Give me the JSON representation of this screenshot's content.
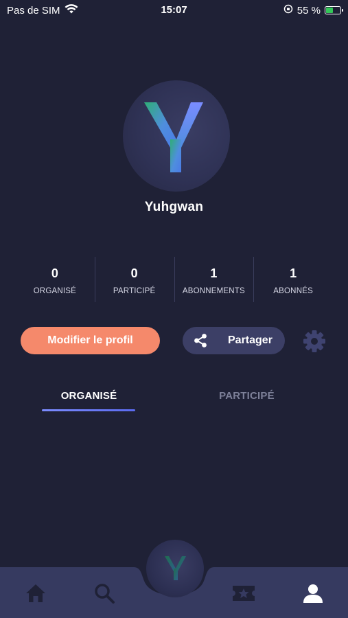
{
  "status_bar": {
    "carrier": "Pas de SIM",
    "time": "15:07",
    "battery_percent": "55 %",
    "battery_level": 0.55
  },
  "profile": {
    "avatar_letter": "Y",
    "username": "Yuhgwan"
  },
  "stats": [
    {
      "value": "0",
      "label": "ORGANISÉ"
    },
    {
      "value": "0",
      "label": "PARTICIPÉ"
    },
    {
      "value": "1",
      "label": "ABONNEMENTS"
    },
    {
      "value": "1",
      "label": "ABONNÉS"
    }
  ],
  "actions": {
    "edit_label": "Modifier le profil",
    "share_label": "Partager"
  },
  "tabs": {
    "organized": "ORGANISÉ",
    "participated": "PARTICIPÉ",
    "active": "organized"
  },
  "bottom_nav": {
    "center_letter": "Y",
    "items": [
      "home-icon",
      "search-icon",
      "ticket-star-icon",
      "profile-icon"
    ],
    "active": "profile-icon"
  },
  "colors": {
    "background": "#1f2136",
    "accent_orange": "#f5896b",
    "accent_blue": "#5b6bf0",
    "nav_background": "#3c3f66"
  }
}
